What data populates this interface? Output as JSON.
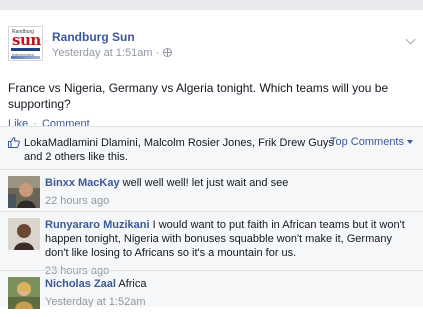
{
  "post": {
    "page_name": "Randburg Sun",
    "timestamp": "Yesterday at 1:51am",
    "meta_separator": "·",
    "text": "France vs Nigeria, Germany vs Algeria tonight. Which teams will you be supporting?",
    "logo": {
      "small": "Randburg",
      "main": "sun",
      "tiny": "independent"
    }
  },
  "actions": {
    "like": "Like",
    "separator": "·",
    "comment": "Comment"
  },
  "likes": {
    "text": "LokaMadlamini Dlamini, Malcolm Rosier Jones, Frik Drew Guys and 2 others like this.",
    "sort_label": "Top Comments"
  },
  "comments": [
    {
      "author": "Binxx MacKay",
      "text": "well well well! let just wait and see",
      "time": "22 hours ago"
    },
    {
      "author": "Runyararo Muzikani",
      "text": "I would want to put faith in African teams but it won't happen tonight, Nigeria with bonuses squabble won't make it, Germany don't like losing to Africans so it's a mountain for us.",
      "time": "23 hours ago"
    },
    {
      "author": "Nicholas Zaal",
      "text": "Africa",
      "time": "Yesterday at 1:52am"
    }
  ],
  "colors": {
    "link": "#3b5998",
    "meta": "#9197a3",
    "text": "#141823",
    "ufi_bg": "#f6f7f8"
  }
}
